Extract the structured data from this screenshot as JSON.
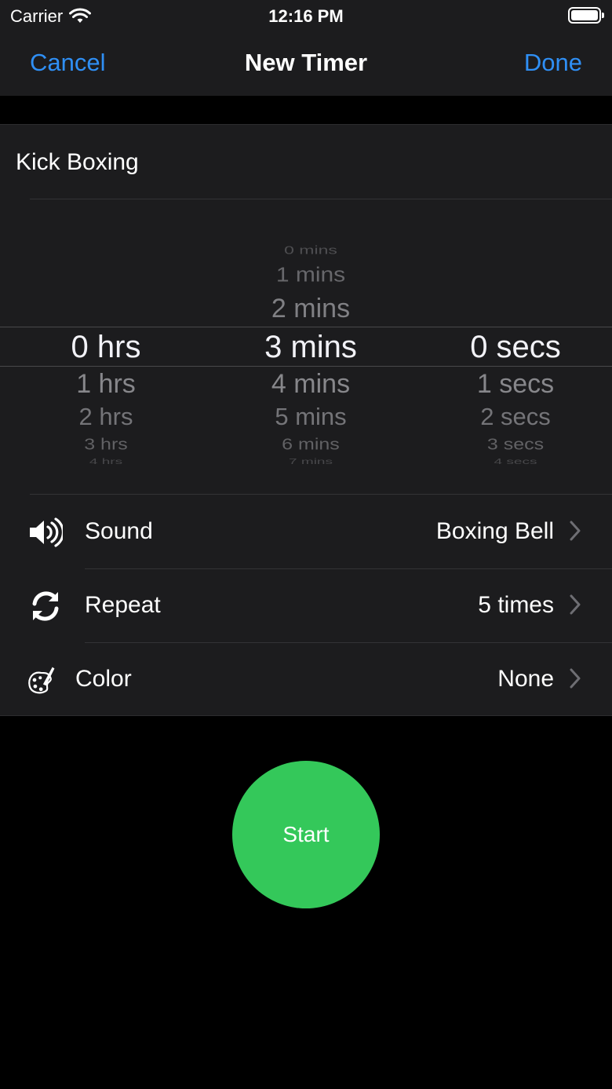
{
  "status_bar": {
    "carrier": "Carrier",
    "time": "12:16 PM"
  },
  "nav": {
    "cancel": "Cancel",
    "title": "New Timer",
    "done": "Done"
  },
  "timer_name": {
    "value": "Kick Boxing"
  },
  "picker": {
    "hours": {
      "above": [],
      "selected": "0 hrs",
      "below": [
        "1 hrs",
        "2 hrs",
        "3 hrs",
        "4 hrs"
      ]
    },
    "minutes": {
      "above": [
        "0 mins",
        "1 mins",
        "2 mins"
      ],
      "selected": "3 mins",
      "below": [
        "4 mins",
        "5 mins",
        "6 mins",
        "7 mins"
      ]
    },
    "seconds": {
      "above": [],
      "selected": "0 secs",
      "below": [
        "1 secs",
        "2 secs",
        "3 secs",
        "4 secs"
      ]
    }
  },
  "settings": {
    "sound": {
      "label": "Sound",
      "value": "Boxing Bell",
      "icon": "speaker-icon"
    },
    "repeat": {
      "label": "Repeat",
      "value": "5 times",
      "icon": "repeat-icon"
    },
    "color": {
      "label": "Color",
      "value": "None",
      "icon": "palette-icon"
    }
  },
  "start_button": {
    "label": "Start",
    "color": "#34c85a"
  },
  "colors": {
    "accent": "#2f8ff5",
    "background": "#000000",
    "surface": "#1c1c1e"
  }
}
